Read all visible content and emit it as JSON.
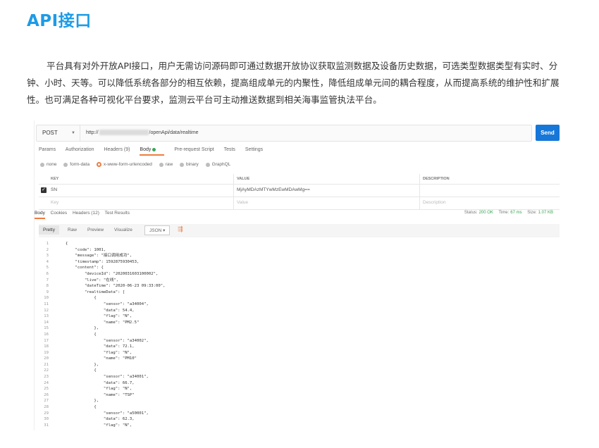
{
  "page": {
    "title": "API接口",
    "intro": "平台具有对外开放API接口，用户无需访问源码即可通过数据开放协议获取监测数据及设备历史数据，可选类型数据类型有实时、分钟、小时、天等。可以降低系统各部分的相互依赖，提高组成单元的内聚性，降低组成单元间的耦合程度，从而提高系统的维护性和扩展性。也可满足各种可视化平台要求，监测云平台可主动推送数据到相关海事监管执法平台。"
  },
  "request": {
    "method": "POST",
    "url_prefix": "http://",
    "url_suffix": "/openApi/data/realtime",
    "send_label": "Send"
  },
  "request_tabs": [
    "Params",
    "Authorization",
    "Headers (9)",
    "Body",
    "Pre-request Script",
    "Tests",
    "Settings"
  ],
  "body_types": [
    "none",
    "form-data",
    "x-www-form-urlencoded",
    "raw",
    "binary",
    "GraphQL"
  ],
  "params_table": {
    "headers": [
      "KEY",
      "VALUE",
      "DESCRIPTION"
    ],
    "rows": [
      {
        "key": "SN",
        "value": "MjAyMDAzMTYwMzEwMDAwMg==",
        "description": ""
      }
    ],
    "placeholder": {
      "key": "Key",
      "value": "Value",
      "description": "Description"
    }
  },
  "response_tabs": [
    "Body",
    "Cookies",
    "Headers (12)",
    "Test Results"
  ],
  "response_status": {
    "status_label": "Status:",
    "status": "200 OK",
    "time_label": "Time:",
    "time": "67 ms",
    "size_label": "Size:",
    "size": "1.07 KB"
  },
  "view_modes": [
    "Pretty",
    "Raw",
    "Preview",
    "Visualize"
  ],
  "format": "JSON",
  "code_lines": [
    "{",
    "    \"code\": 1001,",
    "    \"message\": \"接口调用成功\",",
    "    \"timestamp\": 1592875930453,",
    "    \"content\": {",
    "        \"deviceId\": \"2020031603100002\",",
    "        \"live\": \"在线\",",
    "        \"dateTime\": \"2020-06-23 09:33:00\",",
    "        \"realtimeData\": [",
    "            {",
    "                \"sensor\": \"a34004\",",
    "                \"data\": 54.4,",
    "                \"flag\": \"N\",",
    "                \"name\": \"PM2.5\"",
    "            },",
    "            {",
    "                \"sensor\": \"a34002\",",
    "                \"data\": 72.1,",
    "                \"flag\": \"N\",",
    "                \"name\": \"PM10\"",
    "            },",
    "            {",
    "                \"sensor\": \"a34001\",",
    "                \"data\": 66.7,",
    "                \"flag\": \"N\",",
    "                \"name\": \"TSP\"",
    "            },",
    "            {",
    "                \"sensor\": \"a50001\",",
    "                \"data\": 62.3,",
    "                \"flag\": \"N\","
  ],
  "colors": {
    "title": "#1d9be6",
    "send": "#1677d9",
    "accent": "#f07b3f",
    "ok": "#3aa655"
  }
}
